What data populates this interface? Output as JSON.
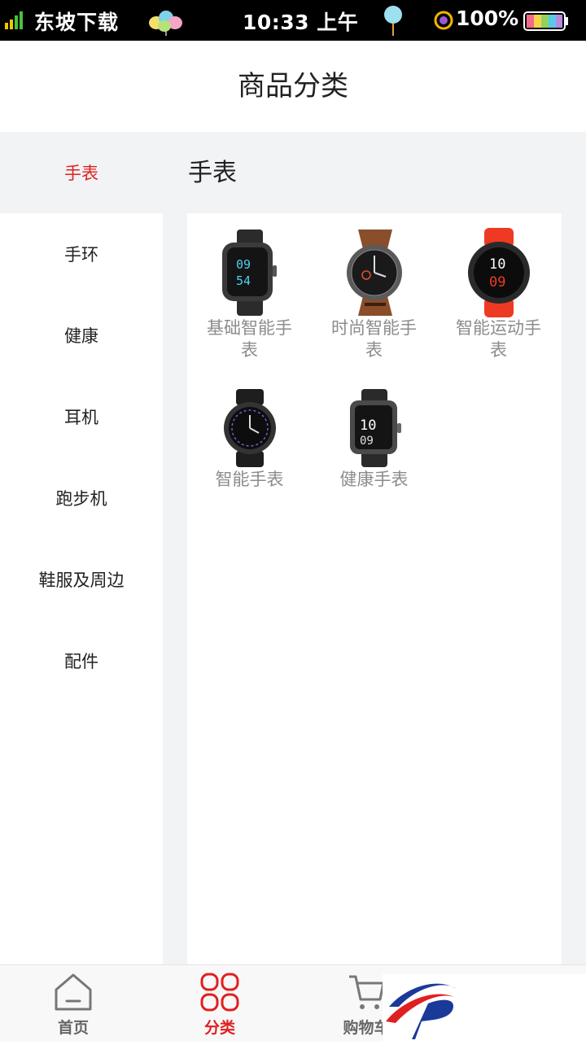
{
  "status_bar": {
    "carrier": "东坡下载",
    "time": "10:33 上午",
    "battery": "100%"
  },
  "header": {
    "title": "商品分类"
  },
  "sidebar": {
    "items": [
      {
        "label": "手表",
        "active": true
      },
      {
        "label": "手环"
      },
      {
        "label": "健康"
      },
      {
        "label": "耳机"
      },
      {
        "label": "跑步机"
      },
      {
        "label": "鞋服及周边"
      },
      {
        "label": "配件"
      }
    ]
  },
  "category": {
    "title": "手表",
    "products": [
      {
        "name": "基础智能手表",
        "icon": "square-smartwatch-icon"
      },
      {
        "name": "时尚智能手表",
        "icon": "round-leather-watch-icon"
      },
      {
        "name": "智能运动手表",
        "icon": "red-sport-watch-icon"
      },
      {
        "name": "智能手表",
        "icon": "round-black-watch-icon"
      },
      {
        "name": "健康手表",
        "icon": "square-health-watch-icon"
      }
    ]
  },
  "tab_bar": {
    "tabs": [
      {
        "label": "首页",
        "icon": "home-icon"
      },
      {
        "label": "分类",
        "icon": "category-grid-icon",
        "active": true
      },
      {
        "label": "购物车",
        "icon": "cart-icon"
      },
      {
        "label": "",
        "icon": "profile-icon"
      }
    ]
  },
  "colors": {
    "accent": "#e02020",
    "background": "#f2f3f5",
    "muted_text": "#8c8c8c"
  }
}
